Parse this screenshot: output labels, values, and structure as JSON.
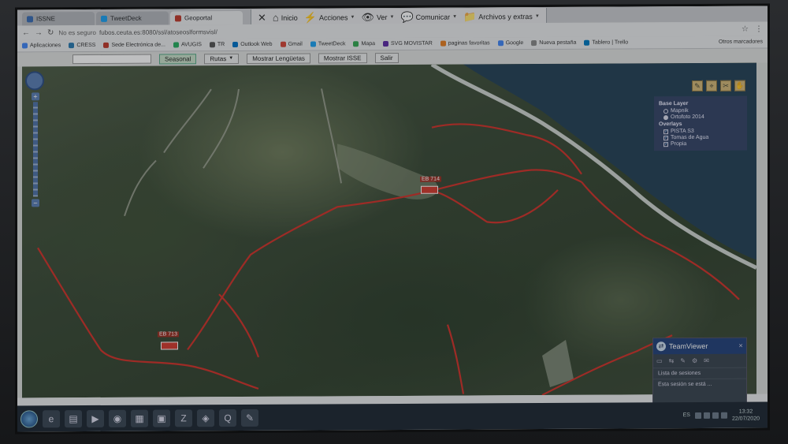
{
  "tabs": [
    {
      "label": "ISSNE",
      "color": "#3a6db5"
    },
    {
      "label": "TweetDeck",
      "color": "#1da1f2"
    },
    {
      "label": "Geoportal",
      "color": "#c0392b"
    }
  ],
  "teamviewer_toolbar": {
    "close_glyph": "✕",
    "items": [
      {
        "icon": "house-icon",
        "glyph": "⌂",
        "label": "Inicio"
      },
      {
        "icon": "lightning-icon",
        "glyph": "⚡",
        "label": "Acciones",
        "caret": "▼"
      },
      {
        "icon": "eye-icon",
        "glyph": "👁",
        "label": "Ver",
        "caret": "▼"
      },
      {
        "icon": "chat-icon",
        "glyph": "💬",
        "label": "Comunicar",
        "caret": "▼"
      },
      {
        "icon": "folder-icon",
        "glyph": "📁",
        "label": "Archivos y extras",
        "caret": "▼"
      }
    ]
  },
  "address_bar": {
    "insecure_label": "No es seguro",
    "url": "fubos.ceuta.es:8080/ssl/atoseoslformsvisl/",
    "glyphs": {
      "back": "←",
      "forward": "→",
      "reload": "↻",
      "star": "☆",
      "menu": "⋮"
    }
  },
  "bookmarks": [
    {
      "label": "Aplicaciones",
      "color": "#4285f4"
    },
    {
      "label": "CRESS",
      "color": "#2a7ab0"
    },
    {
      "label": "Sede Electrónica de...",
      "color": "#c0392b"
    },
    {
      "label": "AVUGIS",
      "color": "#27ae60"
    },
    {
      "label": "TR",
      "color": "#555555"
    },
    {
      "label": "Outlook Web",
      "color": "#0072c6"
    },
    {
      "label": "Gmail",
      "color": "#d44638"
    },
    {
      "label": "TweetDeck",
      "color": "#1da1f2"
    },
    {
      "label": "Mapa",
      "color": "#34a853"
    },
    {
      "label": "SVG MOVISTAR",
      "color": "#5e2ca5"
    },
    {
      "label": "paginas favoritas",
      "color": "#e67e22"
    },
    {
      "label": "Google",
      "color": "#4285f4"
    },
    {
      "label": "Nueva pestaña",
      "color": "#888888"
    },
    {
      "label": "Tablero | Trello",
      "color": "#0079bf"
    }
  ],
  "bookmarks_others": "Otros marcadores",
  "app_toolbar": {
    "buttons": [
      {
        "label": "Seasonal",
        "selected": true
      },
      {
        "label": "Rutas",
        "caret": "▼",
        "selected": false
      },
      {
        "label": "Mostrar Lengüetas",
        "selected": false
      },
      {
        "label": "Mostrar ISSE",
        "selected": false
      },
      {
        "label": "Salir",
        "selected": false
      }
    ]
  },
  "map": {
    "zoom_plus": "+",
    "zoom_minus": "−",
    "layer_tools": [
      "✎",
      "⌖",
      "✂",
      "✋"
    ],
    "layer_panel": {
      "base_header": "Base Layer",
      "base_layers": [
        {
          "label": "Mapnik",
          "on": false
        },
        {
          "label": "Ortofoto 2014",
          "on": true
        }
      ],
      "overlays_header": "Overlays",
      "overlays": [
        {
          "label": "PISTA S3",
          "on": true
        },
        {
          "label": "Tomas de Agua",
          "on": true
        },
        {
          "label": "Propia",
          "on": true
        }
      ],
      "check_glyph": "✓"
    },
    "markers": [
      {
        "label": "EB 714"
      },
      {
        "label": "EB 713"
      }
    ]
  },
  "teamviewer_panel": {
    "logo_glyph": "⇄",
    "close_glyph": "✕",
    "title": "TeamViewer",
    "tool_glyphs": [
      "▭",
      "⇆",
      "✎",
      "⚙",
      "✉"
    ],
    "lines": [
      "Lista de sesiones",
      "Esta sesión se está ..."
    ]
  },
  "taskbar": {
    "apps": [
      {
        "name": "ie-icon",
        "glyph": "e"
      },
      {
        "name": "explorer-icon",
        "glyph": "▤"
      },
      {
        "name": "media-icon",
        "glyph": "▶"
      },
      {
        "name": "chrome-icon",
        "glyph": "◉"
      },
      {
        "name": "calculator-icon",
        "glyph": "▦"
      },
      {
        "name": "files-icon",
        "glyph": "▣"
      },
      {
        "name": "zip-icon",
        "glyph": "Z"
      },
      {
        "name": "gis-icon",
        "glyph": "◈"
      },
      {
        "name": "q-icon",
        "glyph": "Q"
      },
      {
        "name": "paint-icon",
        "glyph": "✎"
      }
    ],
    "lang": "ES",
    "time": "13:32",
    "date": "22/07/2020"
  },
  "colors": {
    "route": "#d3332a",
    "sea": "#244257",
    "coast": "#cfd5d0"
  }
}
